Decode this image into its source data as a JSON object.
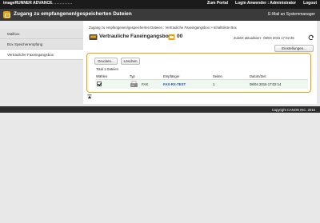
{
  "app": {
    "brand": "imageRUNNER ADVANCE",
    "top_links": [
      "Zum Portal",
      "Login Anwender : Administrator",
      "Logout"
    ]
  },
  "header": {
    "title": "Zugang zu empfangenen/gespeicherten Dateien",
    "mail_link": "E-Mail an Systemmanager"
  },
  "sidebar": {
    "items": [
      "Mailbox",
      "Box Speicherempfang",
      "Vertrauliche Faxeingangsbox"
    ],
    "active_index": 2
  },
  "main": {
    "breadcrumb": "Zugang zu empfangenen/gespeicherten Dateien : Vertrauliche Faxeingangsbox > Inhaltsliste Box",
    "box_title": "Vertrauliche Faxeingangsbox",
    "box_number": "00",
    "updated": "Zuletzt aktualisiert : 08/04 2015 17:02:35",
    "settings_button": "Einstellungen...",
    "print_button": "Drucken...",
    "delete_button": "Löschen",
    "total": "Total 1 Dateien",
    "columns": [
      "Wählen",
      "Typ",
      "Empfänger",
      "Seiten",
      "Datum/Zeit"
    ],
    "rows": [
      {
        "selected": true,
        "type": "FAX",
        "sender": "FAX-RX-TEST",
        "pages": "1",
        "datetime": "08/04 2015 17:02:14"
      }
    ]
  },
  "footer": {
    "copyright": "Copyright CANON INC. 2015"
  },
  "colors": {
    "accent": "#f0a000",
    "topbar": "#1b1b1b",
    "titlebar": "#3a3a3a",
    "link": "#2a4fb0"
  }
}
